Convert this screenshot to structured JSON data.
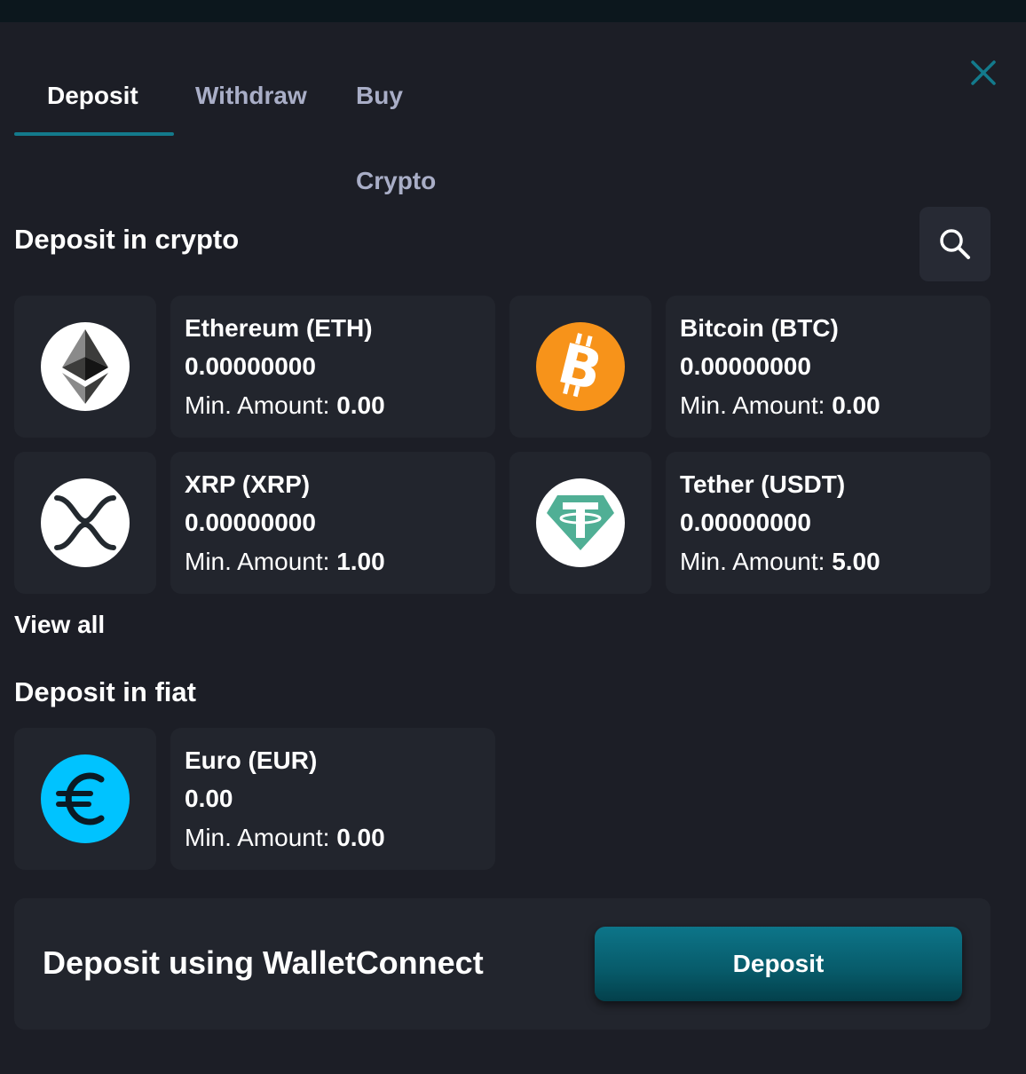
{
  "tabs": [
    {
      "label": "Deposit",
      "active": true
    },
    {
      "label": "Withdraw",
      "active": false
    },
    {
      "label": "Buy Crypto",
      "active": false
    }
  ],
  "crypto_section": {
    "title": "Deposit in crypto",
    "search_icon": "search-icon",
    "assets": [
      {
        "name": "Ethereum (ETH)",
        "balance": "0.00000000",
        "min_label": "Min. Amount:",
        "min_value": "0.00",
        "icon": "ethereum-icon",
        "color": "#ffffff"
      },
      {
        "name": "Bitcoin (BTC)",
        "balance": "0.00000000",
        "min_label": "Min. Amount:",
        "min_value": "0.00",
        "icon": "bitcoin-icon",
        "color": "#f7931a"
      },
      {
        "name": "XRP (XRP)",
        "balance": "0.00000000",
        "min_label": "Min. Amount:",
        "min_value": "1.00",
        "icon": "xrp-icon",
        "color": "#ffffff"
      },
      {
        "name": "Tether (USDT)",
        "balance": "0.00000000",
        "min_label": "Min. Amount:",
        "min_value": "5.00",
        "icon": "tether-icon",
        "color": "#50af95"
      }
    ],
    "view_all": "View all"
  },
  "fiat_section": {
    "title": "Deposit in fiat",
    "assets": [
      {
        "name": "Euro (EUR)",
        "balance": "0.00",
        "min_label": "Min. Amount:",
        "min_value": "0.00",
        "icon": "euro-icon",
        "color": "#00c3ff"
      }
    ]
  },
  "walletconnect": {
    "label": "Deposit using WalletConnect",
    "button": "Deposit"
  },
  "colors": {
    "background": "#1c1e26",
    "card": "#22252d",
    "accent": "#137a8c",
    "inactive_tab": "#a9aec7"
  }
}
